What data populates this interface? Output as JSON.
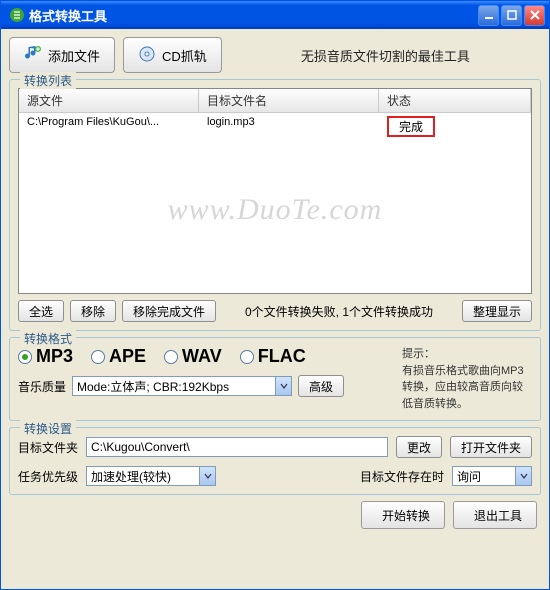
{
  "window": {
    "title": "格式转换工具"
  },
  "toolbar": {
    "add_file": "添加文件",
    "cd_grab": "CD抓轨",
    "slogan": "无损音质文件切割的最佳工具"
  },
  "list_group": {
    "title": "转换列表",
    "cols": {
      "source": "源文件",
      "target": "目标文件名",
      "status": "状态"
    },
    "row": {
      "source": "C:\\Program Files\\KuGou\\...",
      "target": "login.mp3",
      "status": "完成"
    },
    "watermark": "www.DuoTe.com",
    "buttons": {
      "select_all": "全选",
      "remove": "移除",
      "remove_done": "移除完成文件",
      "tidy_display": "整理显示"
    },
    "status_text": "0个文件转换失败, 1个文件转换成功"
  },
  "format_group": {
    "title": "转换格式",
    "options": [
      "MP3",
      "APE",
      "WAV",
      "FLAC"
    ],
    "selected": "MP3",
    "hint_title": "提示：",
    "hint_body": "有损音乐格式歌曲向MP3转换，应由较高音质向较低音质转换。",
    "quality_label": "音乐质量",
    "quality_value": "Mode:立体声; CBR:192Kbps",
    "advanced": "高级"
  },
  "settings_group": {
    "title": "转换设置",
    "target_folder_label": "目标文件夹",
    "target_folder_value": "C:\\Kugou\\Convert\\",
    "change": "更改",
    "open_folder": "打开文件夹",
    "priority_label": "任务优先级",
    "priority_value": "加速处理(较快)",
    "exists_label": "目标文件存在时",
    "exists_value": "询问"
  },
  "footer": {
    "start": "开始转换",
    "exit": "退出工具"
  }
}
